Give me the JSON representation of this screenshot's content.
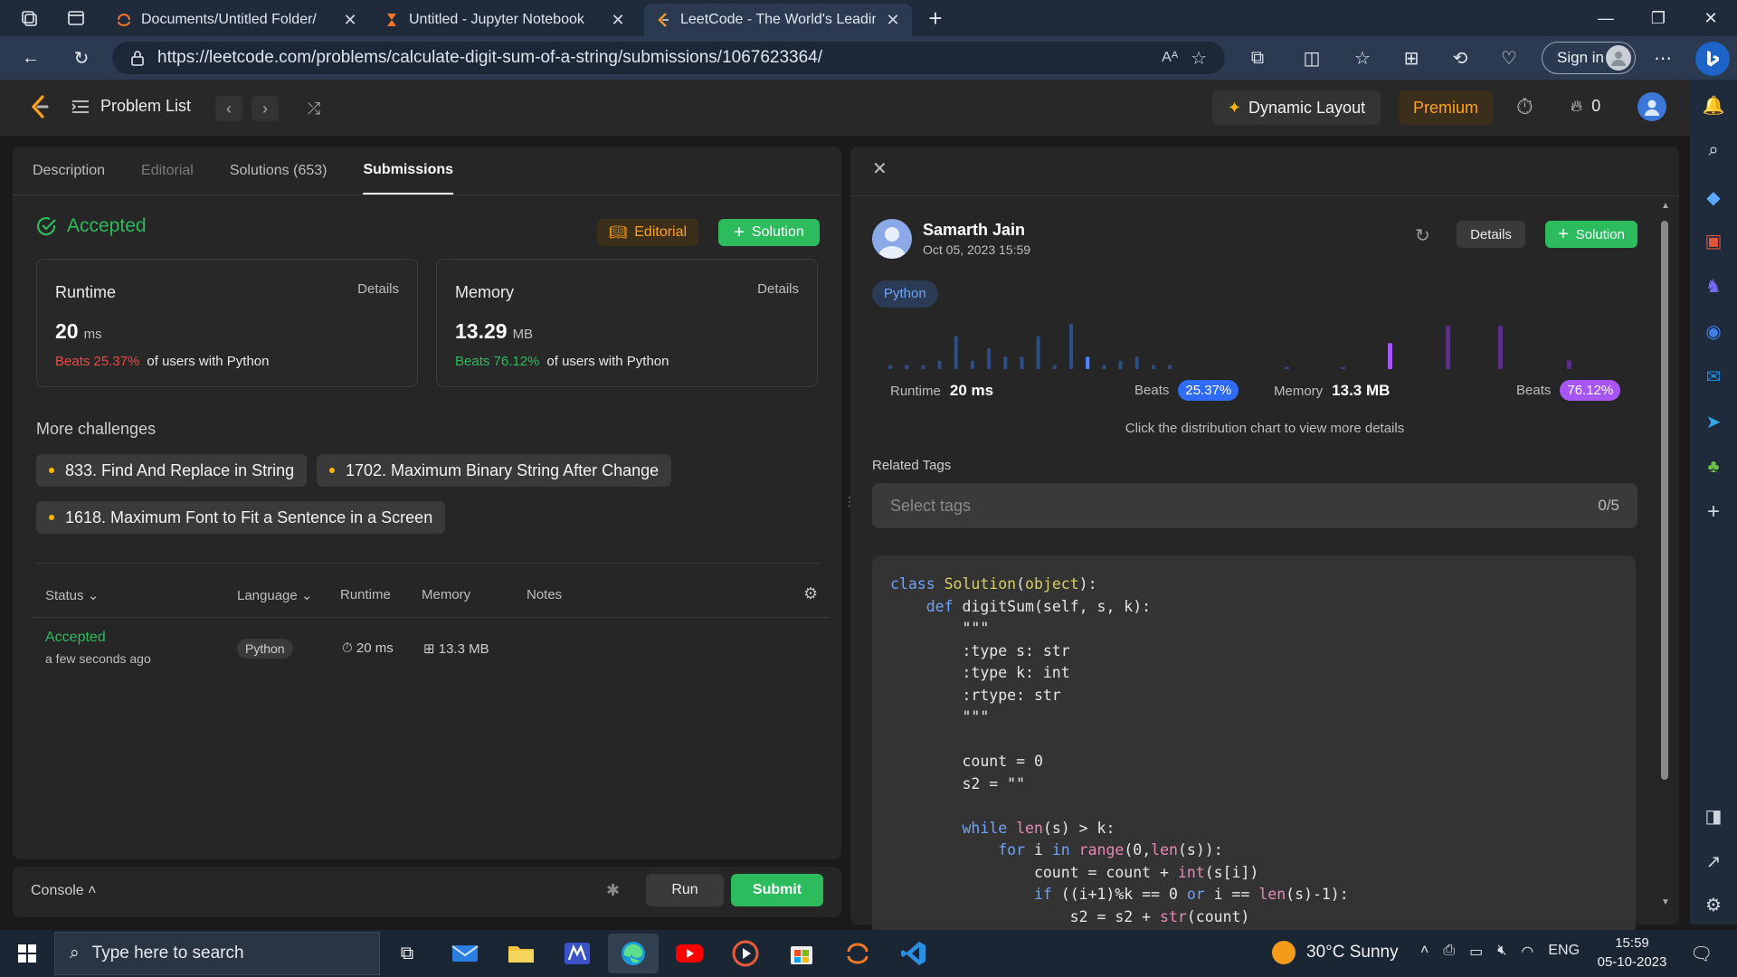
{
  "browser": {
    "tabs": [
      {
        "title": "Documents/Untitled Folder/",
        "icon": "jupyter-icon"
      },
      {
        "title": "Untitled - Jupyter Notebook",
        "icon": "hourglass-icon"
      },
      {
        "title": "LeetCode - The World's Leading",
        "icon": "leetcode-icon",
        "active": true
      }
    ],
    "url": "https://leetcode.com/problems/calculate-digit-sum-of-a-string/submissions/1067623364/",
    "sign_in": "Sign in"
  },
  "topnav": {
    "problem_list": "Problem List",
    "dynamic_layout": "Dynamic Layout",
    "premium": "Premium",
    "streak_count": "0"
  },
  "left_panel": {
    "tabs": [
      "Description",
      "Editorial",
      "Solutions (653)",
      "Submissions"
    ],
    "status": "Accepted",
    "editorial_btn": "Editorial",
    "solution_btn": "Solution",
    "runtime": {
      "label": "Runtime",
      "details": "Details",
      "value": "20",
      "unit": "ms",
      "beats": "Beats 25.37%",
      "suffix": "of users with Python"
    },
    "memory": {
      "label": "Memory",
      "details": "Details",
      "value": "13.29",
      "unit": "MB",
      "beats": "Beats 76.12%",
      "suffix": "of users with Python"
    },
    "more_challenges": "More challenges",
    "challenges": [
      "833. Find And Replace in String",
      "1702. Maximum Binary String After Change",
      "1618. Maximum Font to Fit a Sentence in a Screen"
    ],
    "table": {
      "headers": {
        "status": "Status",
        "language": "Language",
        "runtime": "Runtime",
        "memory": "Memory",
        "notes": "Notes"
      },
      "row": {
        "status": "Accepted",
        "time": "a few seconds ago",
        "language": "Python",
        "runtime": "20 ms",
        "memory": "13.3 MB"
      }
    },
    "console": "Console",
    "run": "Run",
    "submit": "Submit"
  },
  "right_panel": {
    "user": "Samarth Jain",
    "date": "Oct 05, 2023 15:59",
    "details_btn": "Details",
    "solution_btn": "Solution",
    "language": "Python",
    "runtime_label": "Runtime",
    "runtime_value": "20 ms",
    "beats_label": "Beats",
    "runtime_beats": "25.37%",
    "memory_label": "Memory",
    "memory_value": "13.3 MB",
    "memory_beats": "76.12%",
    "chart_hint": "Click the distribution chart to view more details",
    "related_tags": "Related Tags",
    "tags_placeholder": "Select tags",
    "tags_count": "0/5"
  },
  "chart_data": {
    "type": "bar",
    "runtime_bars": [
      1,
      1,
      1,
      2,
      8,
      2,
      5,
      3,
      3,
      8,
      1,
      11,
      3,
      1,
      2,
      3,
      1,
      1
    ],
    "memory_bars": [
      0.5,
      0.5,
      6,
      10,
      10,
      2
    ],
    "highlight_color_runtime": "#2e6cf5",
    "highlight_color_memory": "#a855f7"
  },
  "code_lines": [
    [
      [
        "kw",
        "class "
      ],
      [
        "cls",
        "Solution"
      ],
      [
        "fn",
        "("
      ],
      [
        "cls",
        "object"
      ],
      [
        "fn",
        "):"
      ]
    ],
    [
      [
        "fn",
        "    "
      ],
      [
        "kw",
        "def "
      ],
      [
        "fn",
        "digitSum(self, s, k):"
      ]
    ],
    [
      [
        "fn",
        "        \"\"\""
      ]
    ],
    [
      [
        "fn",
        "        :type s: str"
      ]
    ],
    [
      [
        "fn",
        "        :type k: int"
      ]
    ],
    [
      [
        "fn",
        "        :rtype: str"
      ]
    ],
    [
      [
        "fn",
        "        \"\"\""
      ]
    ],
    [
      [
        "fn",
        ""
      ]
    ],
    [
      [
        "fn",
        "        count = 0"
      ]
    ],
    [
      [
        "fn",
        "        s2 = \"\""
      ]
    ],
    [
      [
        "fn",
        ""
      ]
    ],
    [
      [
        "fn",
        "        "
      ],
      [
        "kw",
        "while "
      ],
      [
        "bi",
        "len"
      ],
      [
        "fn",
        "(s) > k:"
      ]
    ],
    [
      [
        "fn",
        "            "
      ],
      [
        "kw",
        "for "
      ],
      [
        "fn",
        "i "
      ],
      [
        "kw",
        "in "
      ],
      [
        "bi",
        "range"
      ],
      [
        "fn",
        "(0,"
      ],
      [
        "bi",
        "len"
      ],
      [
        "fn",
        "(s)):"
      ]
    ],
    [
      [
        "fn",
        "                count = count + "
      ],
      [
        "bi",
        "int"
      ],
      [
        "fn",
        "(s[i])"
      ]
    ],
    [
      [
        "fn",
        "                "
      ],
      [
        "kw",
        "if "
      ],
      [
        "fn",
        "((i+1)%k == 0 "
      ],
      [
        "kw",
        "or "
      ],
      [
        "fn",
        "i == "
      ],
      [
        "bi",
        "len"
      ],
      [
        "fn",
        "(s)-1):"
      ]
    ],
    [
      [
        "fn",
        "                    s2 = s2 + "
      ],
      [
        "bi",
        "str"
      ],
      [
        "fn",
        "(count)"
      ]
    ]
  ],
  "taskbar": {
    "search_placeholder": "Type here to search",
    "weather": "30°C  Sunny",
    "language": "ENG",
    "time": "15:59",
    "date": "05-10-2023"
  }
}
